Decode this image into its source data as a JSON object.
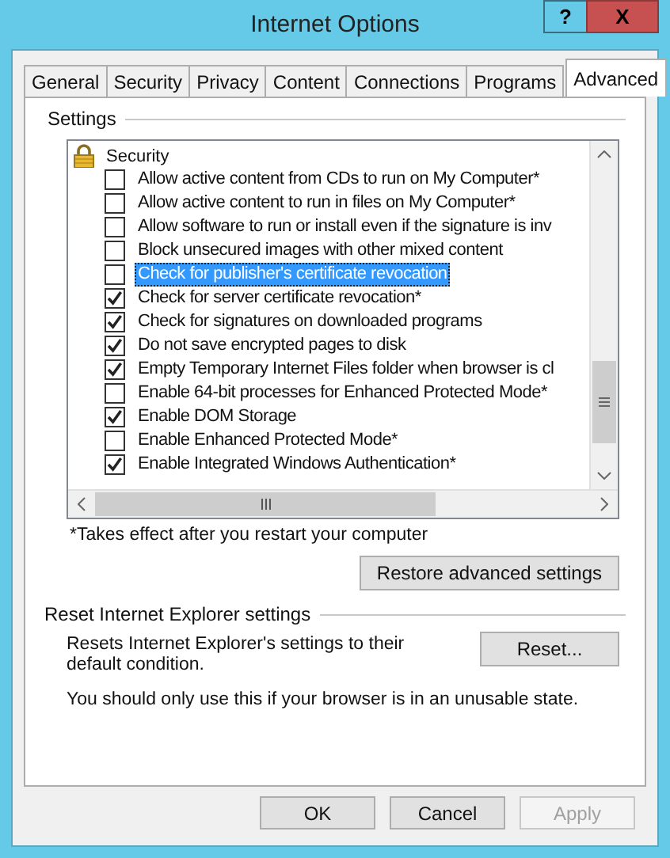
{
  "window": {
    "title": "Internet Options",
    "help_button": "?",
    "close_button": "X"
  },
  "tabs": [
    {
      "label": "General",
      "selected": false
    },
    {
      "label": "Security",
      "selected": false
    },
    {
      "label": "Privacy",
      "selected": false
    },
    {
      "label": "Content",
      "selected": false
    },
    {
      "label": "Connections",
      "selected": false
    },
    {
      "label": "Programs",
      "selected": false
    },
    {
      "label": "Advanced",
      "selected": true
    }
  ],
  "settings": {
    "title": "Settings",
    "tree": [
      {
        "label": "Security",
        "children": [
          {
            "label": "Allow active content from CDs to run on My Computer*",
            "checked": false,
            "selected": false
          },
          {
            "label": "Allow active content to run in files on My Computer*",
            "checked": false,
            "selected": false
          },
          {
            "label": "Allow software to run or install even if the signature is inv",
            "checked": false,
            "selected": false
          },
          {
            "label": "Block unsecured images with other mixed content",
            "checked": false,
            "selected": false
          },
          {
            "label": "Check for publisher's certificate revocation",
            "checked": false,
            "selected": true
          },
          {
            "label": "Check for server certificate revocation*",
            "checked": true,
            "selected": false
          },
          {
            "label": "Check for signatures on downloaded programs",
            "checked": true,
            "selected": false
          },
          {
            "label": "Do not save encrypted pages to disk",
            "checked": true,
            "selected": false
          },
          {
            "label": "Empty Temporary Internet Files folder when browser is cl",
            "checked": true,
            "selected": false
          },
          {
            "label": "Enable 64-bit processes for Enhanced Protected Mode*",
            "checked": false,
            "selected": false
          },
          {
            "label": "Enable DOM Storage",
            "checked": true,
            "selected": false
          },
          {
            "label": "Enable Enhanced Protected Mode*",
            "checked": false,
            "selected": false
          },
          {
            "label": "Enable Integrated Windows Authentication*",
            "checked": true,
            "selected": false
          }
        ]
      }
    ],
    "note": "*Takes effect after you restart your computer",
    "restore_button": "Restore advanced settings"
  },
  "reset": {
    "title": "Reset Internet Explorer settings",
    "description": "Resets Internet Explorer's settings to their default condition.",
    "button": "Reset...",
    "warning": "You should only use this if your browser is in an unusable state."
  },
  "buttons": [
    {
      "label": "OK",
      "disabled": false
    },
    {
      "label": "Cancel",
      "disabled": false
    },
    {
      "label": "Apply",
      "disabled": true
    }
  ]
}
